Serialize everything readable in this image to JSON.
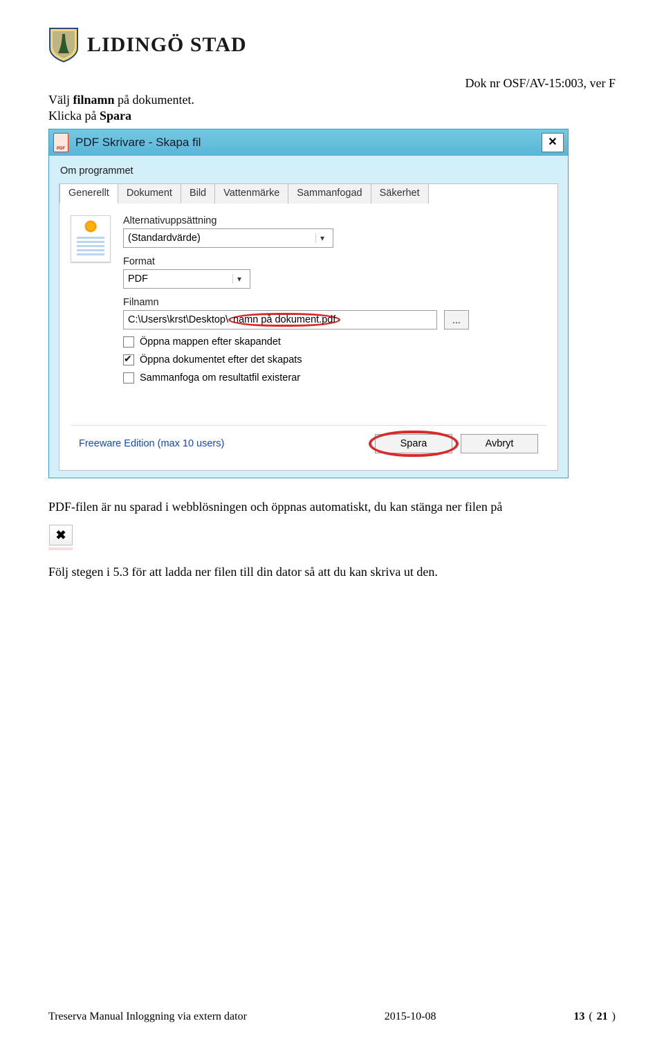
{
  "header": {
    "brand": "LIDINGÖ STAD",
    "docref": "Dok nr OSF/AV-15:003, ver F"
  },
  "intro": {
    "line1_prefix": "Välj ",
    "line1_bold": "filnamn",
    "line1_suffix": " på dokumentet.",
    "line2_prefix": "Klicka på ",
    "line2_bold": "Spara"
  },
  "dialog": {
    "title": "PDF Skrivare - Skapa fil",
    "menubar": "Om programmet",
    "tabs": [
      "Generellt",
      "Dokument",
      "Bild",
      "Vattenmärke",
      "Sammanfogad",
      "Säkerhet"
    ],
    "fields": {
      "altset_label": "Alternativuppsättning",
      "altset_value": "(Standardvärde)",
      "format_label": "Format",
      "format_value": "PDF",
      "filename_label": "Filnamn",
      "filename_path_prefix": "C:\\Users\\krst\\Desktop\\",
      "filename_path_highlight": "namn på dokument.pdf",
      "browse_label": "..."
    },
    "checks": {
      "open_folder": "Öppna mappen efter skapandet",
      "open_doc": "Öppna dokumentet efter det skapats",
      "merge": "Sammanfoga om resultatfil existerar"
    },
    "footer": {
      "freeware": "Freeware Edition (max 10 users)",
      "save": "Spara",
      "cancel": "Avbryt"
    }
  },
  "after": {
    "para1": "PDF-filen är nu sparad i webblösningen och öppnas automatiskt, du kan stänga ner filen på",
    "para2": "Följ stegen i 5.3 för att ladda ner filen till din dator så att du kan skriva ut den.",
    "close_glyph": "✖"
  },
  "footer": {
    "left": "Treserva Manual Inloggning via extern dator",
    "date": "2015-10-08",
    "page_current": "13",
    "page_paren_open": " (",
    "page_total": "21",
    "page_paren_close": ")"
  }
}
